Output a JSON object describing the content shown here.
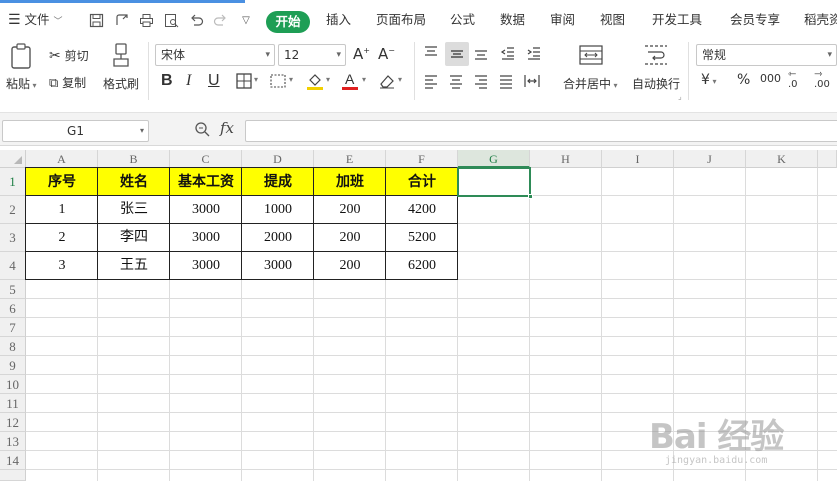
{
  "menu": {
    "file_label": "文件",
    "tabs": [
      "开始",
      "插入",
      "页面布局",
      "公式",
      "数据",
      "审阅",
      "视图",
      "开发工具",
      "会员专享",
      "稻壳资"
    ]
  },
  "ribbon": {
    "paste": "粘贴",
    "cut": "剪切",
    "copy": "复制",
    "format_painter": "格式刷",
    "font_name": "宋体",
    "font_size": "12",
    "bold": "B",
    "italic": "I",
    "underline": "U",
    "merge_center": "合并居中",
    "wrap_text": "自动换行",
    "number_format": "常规",
    "currency": "¥",
    "percent": "%",
    "thousands": "000",
    "inc_decimal": ".0",
    "dec_decimal": ".00"
  },
  "formula_bar": {
    "name_box": "G1",
    "fx": "fx",
    "content": ""
  },
  "sheet": {
    "columns": [
      "A",
      "B",
      "C",
      "D",
      "E",
      "F",
      "G",
      "H",
      "I",
      "J",
      "K"
    ],
    "rows": [
      "1",
      "2",
      "3",
      "4",
      "5",
      "6",
      "7",
      "8",
      "9",
      "10",
      "11",
      "12",
      "13",
      "14"
    ],
    "selected_cell": "G1",
    "header_fill": "#ffff00",
    "table_header": [
      "序号",
      "姓名",
      "基本工资",
      "提成",
      "加班",
      "合计"
    ],
    "table_rows": [
      [
        "1",
        "张三",
        "3000",
        "1000",
        "200",
        "4200"
      ],
      [
        "2",
        "李四",
        "3000",
        "2000",
        "200",
        "5200"
      ],
      [
        "3",
        "王五",
        "3000",
        "3000",
        "200",
        "6200"
      ]
    ]
  },
  "watermark": {
    "brand": "Bai 经验",
    "url": "jingyan.baidu.com"
  }
}
